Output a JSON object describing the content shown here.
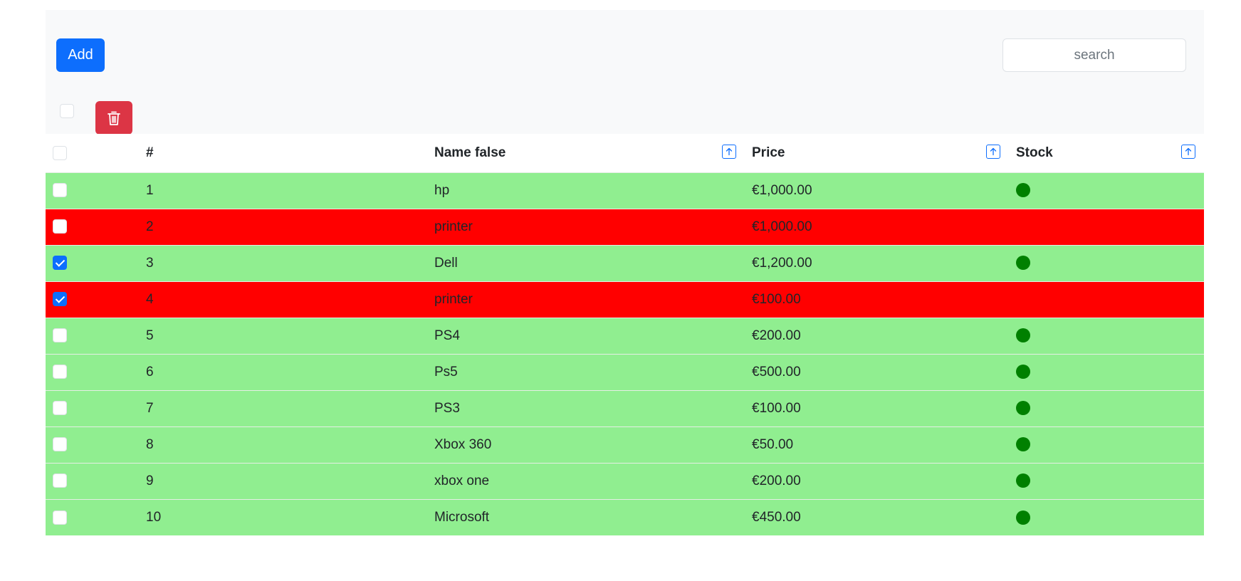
{
  "toolbar": {
    "add_label": "Add",
    "search_placeholder": "search",
    "delete_icon": "trash-icon"
  },
  "colors": {
    "primary": "#0d6efd",
    "danger": "#dc3545",
    "in_stock_row": "#90ee90",
    "out_of_stock_row": "#ff0000",
    "stock_dot": "#008000"
  },
  "table": {
    "headers": {
      "index": "#",
      "name": "Name false",
      "price": "Price",
      "stock": "Stock"
    },
    "rows": [
      {
        "index": "1",
        "name": "hp",
        "price": "€1,000.00",
        "in_stock": true,
        "checked": false
      },
      {
        "index": "2",
        "name": "printer",
        "price": "€1,000.00",
        "in_stock": false,
        "checked": false
      },
      {
        "index": "3",
        "name": "Dell",
        "price": "€1,200.00",
        "in_stock": true,
        "checked": true
      },
      {
        "index": "4",
        "name": "printer",
        "price": "€100.00",
        "in_stock": false,
        "checked": true
      },
      {
        "index": "5",
        "name": "PS4",
        "price": "€200.00",
        "in_stock": true,
        "checked": false
      },
      {
        "index": "6",
        "name": "Ps5",
        "price": "€500.00",
        "in_stock": true,
        "checked": false
      },
      {
        "index": "7",
        "name": "PS3",
        "price": "€100.00",
        "in_stock": true,
        "checked": false
      },
      {
        "index": "8",
        "name": "Xbox 360",
        "price": "€50.00",
        "in_stock": true,
        "checked": false
      },
      {
        "index": "9",
        "name": "xbox one",
        "price": "€200.00",
        "in_stock": true,
        "checked": false
      },
      {
        "index": "10",
        "name": "Microsoft",
        "price": "€450.00",
        "in_stock": true,
        "checked": false
      }
    ]
  }
}
